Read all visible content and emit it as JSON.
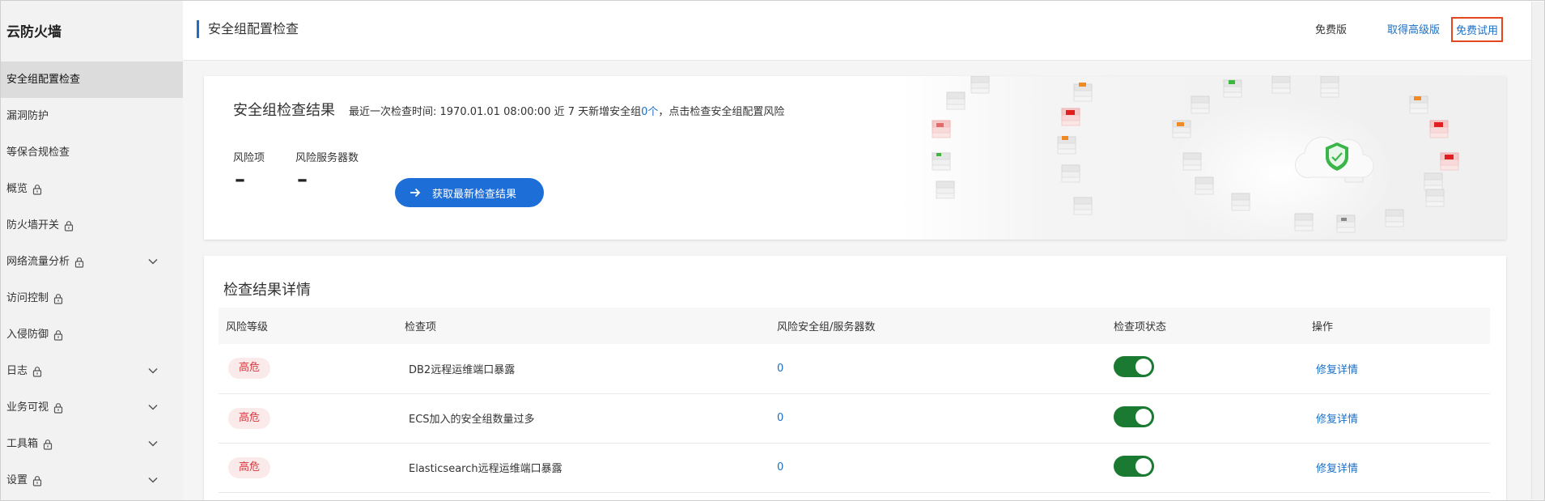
{
  "sidebar": {
    "brand": "云防火墙",
    "items": [
      {
        "label": "安全组配置检查",
        "locked": false,
        "expandable": false,
        "active": true
      },
      {
        "label": "漏洞防护",
        "locked": false,
        "expandable": false,
        "active": false
      },
      {
        "label": "等保合规检查",
        "locked": false,
        "expandable": false,
        "active": false
      },
      {
        "label": "概览",
        "locked": true,
        "expandable": false,
        "active": false
      },
      {
        "label": "防火墙开关",
        "locked": true,
        "expandable": false,
        "active": false
      },
      {
        "label": "网络流量分析",
        "locked": true,
        "expandable": true,
        "active": false
      },
      {
        "label": "访问控制",
        "locked": true,
        "expandable": false,
        "active": false
      },
      {
        "label": "入侵防御",
        "locked": true,
        "expandable": false,
        "active": false
      },
      {
        "label": "日志",
        "locked": true,
        "expandable": true,
        "active": false
      },
      {
        "label": "业务可视",
        "locked": true,
        "expandable": true,
        "active": false
      },
      {
        "label": "工具箱",
        "locked": true,
        "expandable": true,
        "active": false
      },
      {
        "label": "设置",
        "locked": true,
        "expandable": true,
        "active": false
      }
    ]
  },
  "header": {
    "title": "安全组配置检查",
    "free_edition": "免费版",
    "get_advanced": "取得高级版",
    "free_trial": "免费试用"
  },
  "summary": {
    "title": "安全组检查结果",
    "meta_prefix": "最近一次检查时间: 1970.01.01 08:00:00  近 7 天新增安全组",
    "meta_count": "0个",
    "meta_suffix": "，点击检查安全组配置风险",
    "risk_items_label": "风险项",
    "risk_servers_label": "风险服务器数",
    "risk_items_value": "–",
    "risk_servers_value": "–",
    "button_label": "获取最新检查结果"
  },
  "details": {
    "title": "检查结果详情",
    "columns": [
      "风险等级",
      "检查项",
      "风险安全组/服务器数",
      "检查项状态",
      "操作"
    ],
    "rows": [
      {
        "risk": "高危",
        "item": "DB2远程运维端口暴露",
        "count": "0",
        "enabled": true,
        "action": "修复详情"
      },
      {
        "risk": "高危",
        "item": "ECS加入的安全组数量过多",
        "count": "0",
        "enabled": true,
        "action": "修复详情"
      },
      {
        "risk": "高危",
        "item": "Elasticsearch远程运维端口暴露",
        "count": "0",
        "enabled": true,
        "action": "修复详情"
      }
    ]
  },
  "colors": {
    "accent": "#1b6fc6",
    "button": "#1e6ed8",
    "toggle_on": "#1a7a32",
    "risk_high": "#d9363e",
    "trial_border": "#e2471f"
  },
  "icons": {
    "lock": "lock-icon",
    "chevron": "chevron-down-icon",
    "arrow": "arrow-right-icon",
    "collapse": "chevron-left-icon",
    "shield": "shield-check-icon"
  }
}
